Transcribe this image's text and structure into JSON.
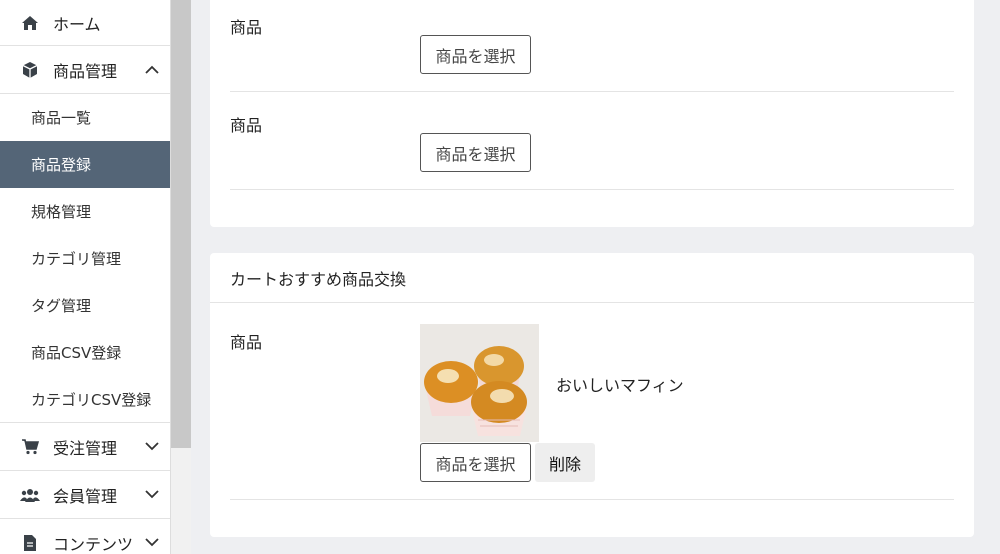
{
  "sidebar": {
    "home": {
      "label": "ホーム",
      "icon": "home-icon"
    },
    "product_mgmt": {
      "label": "商品管理",
      "icon": "box-icon"
    },
    "sub_items": [
      {
        "label": "商品一覧",
        "active": false
      },
      {
        "label": "商品登録",
        "active": true
      },
      {
        "label": "規格管理",
        "active": false
      },
      {
        "label": "カテゴリ管理",
        "active": false
      },
      {
        "label": "タグ管理",
        "active": false
      },
      {
        "label": "商品CSV登録",
        "active": false
      },
      {
        "label": "カテゴリCSV登録",
        "active": false
      }
    ],
    "orders": {
      "label": "受注管理",
      "icon": "cart-icon"
    },
    "members": {
      "label": "会員管理",
      "icon": "users-icon"
    },
    "contents": {
      "label": "コンテンツ",
      "icon": "file-icon"
    }
  },
  "section1": {
    "rows": [
      {
        "label": "商品",
        "select_label": "商品を選択"
      },
      {
        "label": "商品",
        "select_label": "商品を選択"
      }
    ]
  },
  "section2": {
    "title": "カートおすすめ商品交換",
    "row": {
      "label": "商品",
      "product_name": "おいしいマフィン",
      "select_label": "商品を選択",
      "delete_label": "削除"
    }
  },
  "colors": {
    "active_bg": "#546577",
    "page_bg": "#eeeff2"
  }
}
